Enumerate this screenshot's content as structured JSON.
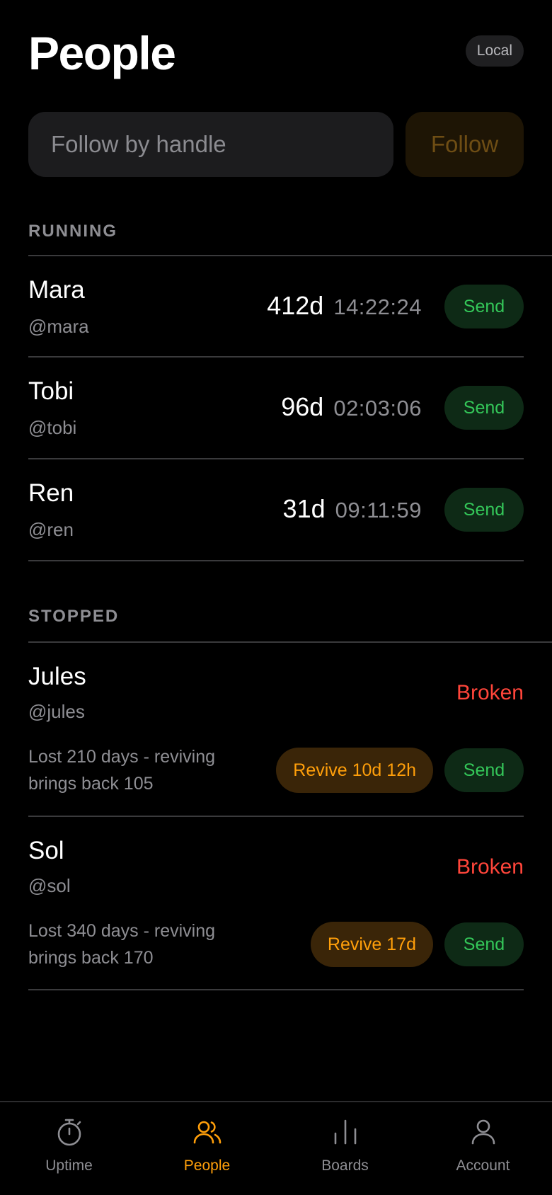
{
  "header": {
    "title": "People",
    "mode_badge": "Local"
  },
  "follow": {
    "placeholder": "Follow by handle",
    "button_label": "Follow"
  },
  "running": {
    "label": "RUNNING",
    "people": [
      {
        "name": "Mara",
        "handle": "@mara",
        "days": "412d",
        "clock": "14:22:24",
        "send_label": "Send"
      },
      {
        "name": "Tobi",
        "handle": "@tobi",
        "days": "96d",
        "clock": "02:03:06",
        "send_label": "Send"
      },
      {
        "name": "Ren",
        "handle": "@ren",
        "days": "31d",
        "clock": "09:11:59",
        "send_label": "Send"
      }
    ]
  },
  "stopped": {
    "label": "STOPPED",
    "people": [
      {
        "name": "Jules",
        "handle": "@jules",
        "status": "Broken",
        "note": "Lost 210 days - reviving brings back 105",
        "revive_label": "Revive 10d 12h",
        "send_label": "Send"
      },
      {
        "name": "Sol",
        "handle": "@sol",
        "status": "Broken",
        "note": "Lost 340 days - reviving brings back 170",
        "revive_label": "Revive 17d",
        "send_label": "Send"
      }
    ]
  },
  "tabs": [
    {
      "label": "Uptime",
      "icon": "stopwatch-icon",
      "active": false
    },
    {
      "label": "People",
      "icon": "people-icon",
      "active": true
    },
    {
      "label": "Boards",
      "icon": "bar-chart-icon",
      "active": false
    },
    {
      "label": "Account",
      "icon": "person-icon",
      "active": false
    }
  ],
  "colors": {
    "background": "#000000",
    "accent": "#ff9f0a",
    "send_text": "#34c759",
    "send_bg": "#0e2a16",
    "broken": "#ff453a",
    "muted": "#8e8e93"
  }
}
